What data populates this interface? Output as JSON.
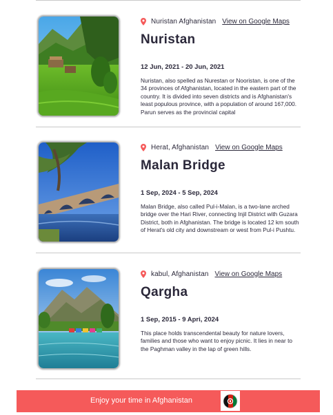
{
  "entries": [
    {
      "location": "Nuristan Afghanistan",
      "maps_link": "View on Google Maps",
      "title": "Nuristan",
      "dates": "12 Jun, 2021 - 20 Jun, 2021",
      "description": "Nuristan, also spelled as Nurestan or Nooristan, is one of the 34 provinces of Afghanistan, located in the eastern part of the country. It is divided into seven districts and is Afghanistan's least populous province, with a population of around 167,000. Parun serves as the provincial capital"
    },
    {
      "location": "Herat, Afghanistan",
      "maps_link": "View on Google Maps",
      "title": "Malan Bridge",
      "dates": "1 Sep, 2024 - 5 Sep, 2024",
      "description": "Malan Bridge, also called Pul-i-Malan, is a two-lane arched bridge over the Hari River, connecting Injil District with Guzara District, both in Afghanistan. The bridge is located 12 km south of Herat's old city and downstream or west from Pul-i Pushtu."
    },
    {
      "location": "kabul, Afghanistan",
      "maps_link": "View on Google Maps",
      "title": "Qargha",
      "dates": "1 Sep, 2015 - 9 Apri, 2024",
      "description": "This place holds transcendental beauty for nature lovers, families and those who want to enjoy picnic. It lies in near to the Paghman valley in the lap of green hills."
    }
  ],
  "footer": {
    "text": "Enjoy your time in Afghanistan"
  },
  "colors": {
    "accent": "#f55a5a",
    "text": "#2b283a",
    "pin": "#f55a5a"
  }
}
